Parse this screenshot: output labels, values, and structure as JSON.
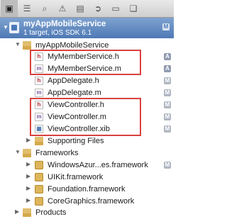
{
  "project": {
    "name": "myAppMobileService",
    "subtitle": "1 target, iOS SDK 6.1",
    "badge": "M"
  },
  "tree": {
    "group": "myAppMobileService",
    "files": [
      {
        "label": "MyMemberService.h",
        "type": "h",
        "badge": "A"
      },
      {
        "label": "MyMemberService.m",
        "type": "m",
        "badge": "A"
      },
      {
        "label": "AppDelegate.h",
        "type": "h",
        "badge": "M"
      },
      {
        "label": "AppDelegate.m",
        "type": "m",
        "badge": "M"
      },
      {
        "label": "ViewController.h",
        "type": "h",
        "badge": "M"
      },
      {
        "label": "ViewController.m",
        "type": "m",
        "badge": "M"
      },
      {
        "label": "ViewController.xib",
        "type": "xib",
        "badge": "M"
      },
      {
        "label": "Supporting Files",
        "type": "folder",
        "badge": ""
      }
    ],
    "frameworks_group": "Frameworks",
    "frameworks": [
      {
        "label": "WindowsAzur...es.framework",
        "badge": "M"
      },
      {
        "label": "UIKit.framework",
        "badge": ""
      },
      {
        "label": "Foundation.framework",
        "badge": ""
      },
      {
        "label": "CoreGraphics.framework",
        "badge": ""
      }
    ],
    "products_group": "Products"
  }
}
